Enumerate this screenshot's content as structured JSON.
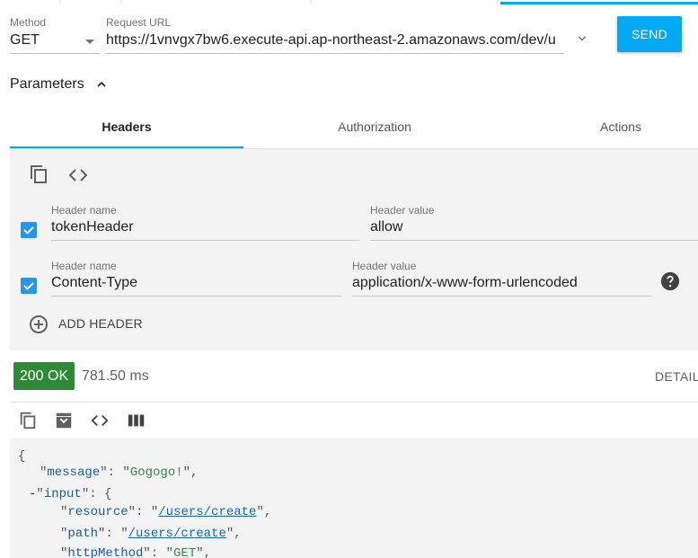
{
  "request": {
    "method_label": "Method",
    "method_value": "GET",
    "url_label": "Request URL",
    "url_value": "https://1vnvgx7bw6.execute-api.ap-northeast-2.amazonaws.com/dev/u",
    "send_label": "SEND"
  },
  "parameters": {
    "toggle_label": "Parameters"
  },
  "tabs": [
    {
      "label": "Headers",
      "active": true
    },
    {
      "label": "Authorization",
      "active": false
    },
    {
      "label": "Actions",
      "active": false
    }
  ],
  "headers": {
    "rows": [
      {
        "name_label": "Header name",
        "name": "tokenHeader",
        "value_label": "Header value",
        "value": "allow",
        "enabled": true
      },
      {
        "name_label": "Header name",
        "name": "Content-Type",
        "value_label": "Header value",
        "value": "application/x-www-form-urlencoded",
        "enabled": true
      }
    ],
    "add_label": "ADD HEADER"
  },
  "response": {
    "status": "200 OK",
    "time": "781.50 ms",
    "details_label": "DETAILS",
    "json": {
      "open_brace": "{",
      "message_key": "message",
      "message_value": "Gogogo!",
      "input_toggle": "-",
      "input_key": "input",
      "input_open": "{",
      "resource_key": "resource",
      "resource_value": "/users/create",
      "path_key": "path",
      "path_value": "/users/create",
      "httpmethod_key": "httpMethod",
      "httpmethod_value": "GET"
    }
  },
  "colors": {
    "accent": "#03a9f4",
    "status_ok": "#2e8b35",
    "checkbox": "#2196f3"
  }
}
